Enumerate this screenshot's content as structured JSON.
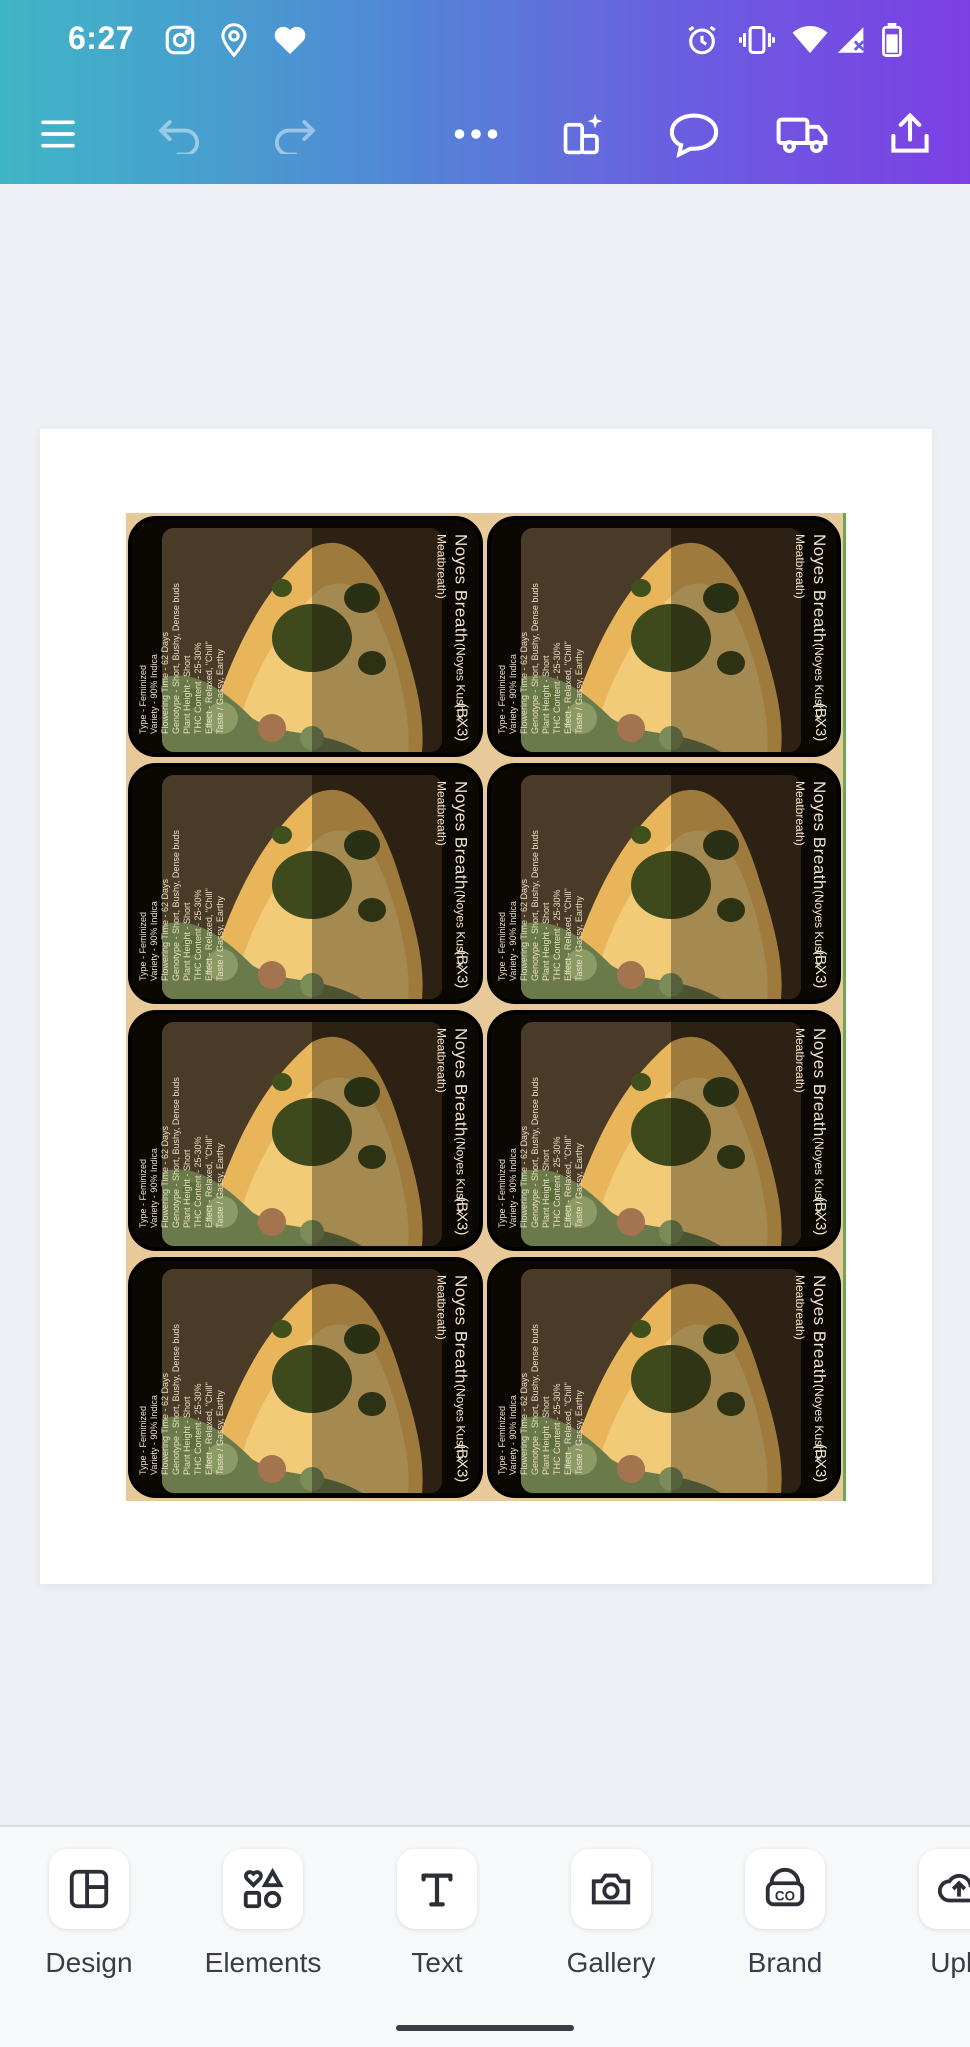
{
  "status_bar": {
    "time": "6:27",
    "left_icons": [
      "instagram-icon",
      "location-pin-icon",
      "heart-icon"
    ],
    "right_icons": [
      "alarm-icon",
      "vibrate-icon",
      "wifi-icon",
      "signal-icon",
      "battery-icon"
    ]
  },
  "toolbar": {
    "menu_icon": "hamburger-menu-icon",
    "undo_icon": "undo-icon",
    "redo_icon": "redo-icon",
    "more_icon": "more-dots-icon",
    "magic_icon": "magic-resize-icon",
    "comment_icon": "comment-icon",
    "delivery_icon": "print-delivery-icon",
    "share_icon": "share-upload-icon",
    "colors": {
      "gradient_start": "#3fb6c6",
      "gradient_end": "#7c3fe4"
    }
  },
  "design": {
    "label": {
      "name": "Noyes Breath",
      "cross": "(Noyes Kush x Meatbreath)",
      "bx": "(BX3)",
      "details": [
        "Type - Feminized",
        "Variety - 90% Indica",
        "Flowering Time - 62 Days",
        "Genotype - Short, Bushy, Dense buds",
        "Plant Height - Short",
        "THC Content - 25-30%",
        "Effect - Relaxed, \"Chill\"",
        "Taste / Gassy, Earthy"
      ]
    },
    "label_count": 8
  },
  "bottom_bar": {
    "items": [
      {
        "label": "Design",
        "icon": "layout-icon"
      },
      {
        "label": "Elements",
        "icon": "shapes-icon"
      },
      {
        "label": "Text",
        "icon": "text-t-icon"
      },
      {
        "label": "Gallery",
        "icon": "camera-icon"
      },
      {
        "label": "Brand",
        "icon": "brand-kit-icon"
      },
      {
        "label": "Uplo",
        "icon": "cloud-upload-icon"
      }
    ]
  }
}
